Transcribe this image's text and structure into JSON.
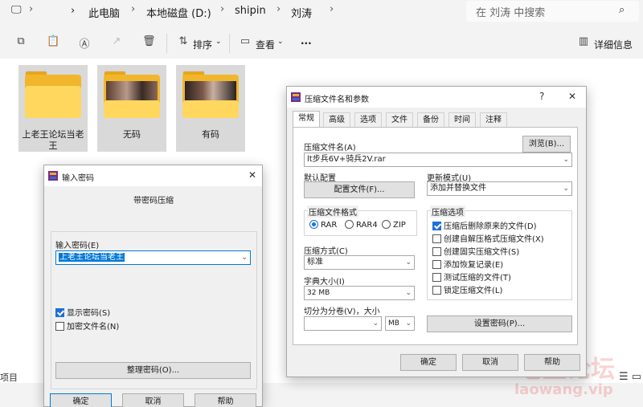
{
  "explorer": {
    "breadcrumb": [
      "此电脑",
      "本地磁盘 (D:)",
      "shipin",
      "刘涛"
    ],
    "search_placeholder": "在 刘涛 中搜索",
    "cmd": {
      "sort": "排序",
      "view": "查看",
      "more": "···",
      "details": "详细信息"
    },
    "folders": [
      {
        "label": "上老王论坛当老王"
      },
      {
        "label": "无码"
      },
      {
        "label": "有码"
      }
    ],
    "status": "项目",
    "watermark": "老王论坛",
    "watermark_url": "laowang.vip"
  },
  "password_dialog": {
    "title": "输入密码",
    "heading": "带密码压缩",
    "input_label": "输入密码(E)",
    "input_value": "上老王论坛当老王",
    "show_password": "显示密码(S)",
    "encrypt_names": "加密文件名(N)",
    "organize_btn": "整理密码(O)...",
    "ok": "确定",
    "cancel": "取消",
    "help": "帮助"
  },
  "archive_dialog": {
    "title": "压缩文件名和参数",
    "help_glyph": "?",
    "tabs": [
      "常规",
      "高级",
      "选项",
      "文件",
      "备份",
      "时间",
      "注释"
    ],
    "archive_name_label": "压缩文件名(A)",
    "browse": "浏览(B)...",
    "archive_name_value": "lt步兵6V+骑兵2V.rar",
    "default_profile_label": "默认配置",
    "profile_btn": "配置文件(F)...",
    "update_mode_label": "更新模式(U)",
    "update_mode_value": "添加并替换文件",
    "format_group": "压缩文件格式",
    "formats": [
      "RAR",
      "RAR4",
      "ZIP"
    ],
    "method_label": "压缩方式(C)",
    "method_value": "标准",
    "dict_label": "字典大小(I)",
    "dict_value": "32 MB",
    "split_label": "切分为分卷(V)，大小",
    "split_value": "",
    "split_unit": "MB",
    "options_group": "压缩选项",
    "options": [
      {
        "label": "压缩后删除原来的文件(D)",
        "checked": true
      },
      {
        "label": "创建自解压格式压缩文件(X)",
        "checked": false
      },
      {
        "label": "创建固实压缩文件(S)",
        "checked": false
      },
      {
        "label": "添加恢复记录(E)",
        "checked": false
      },
      {
        "label": "测试压缩的文件(T)",
        "checked": false
      },
      {
        "label": "锁定压缩文件(L)",
        "checked": false
      }
    ],
    "set_password": "设置密码(P)...",
    "ok": "确定",
    "cancel": "取消",
    "help": "帮助"
  }
}
